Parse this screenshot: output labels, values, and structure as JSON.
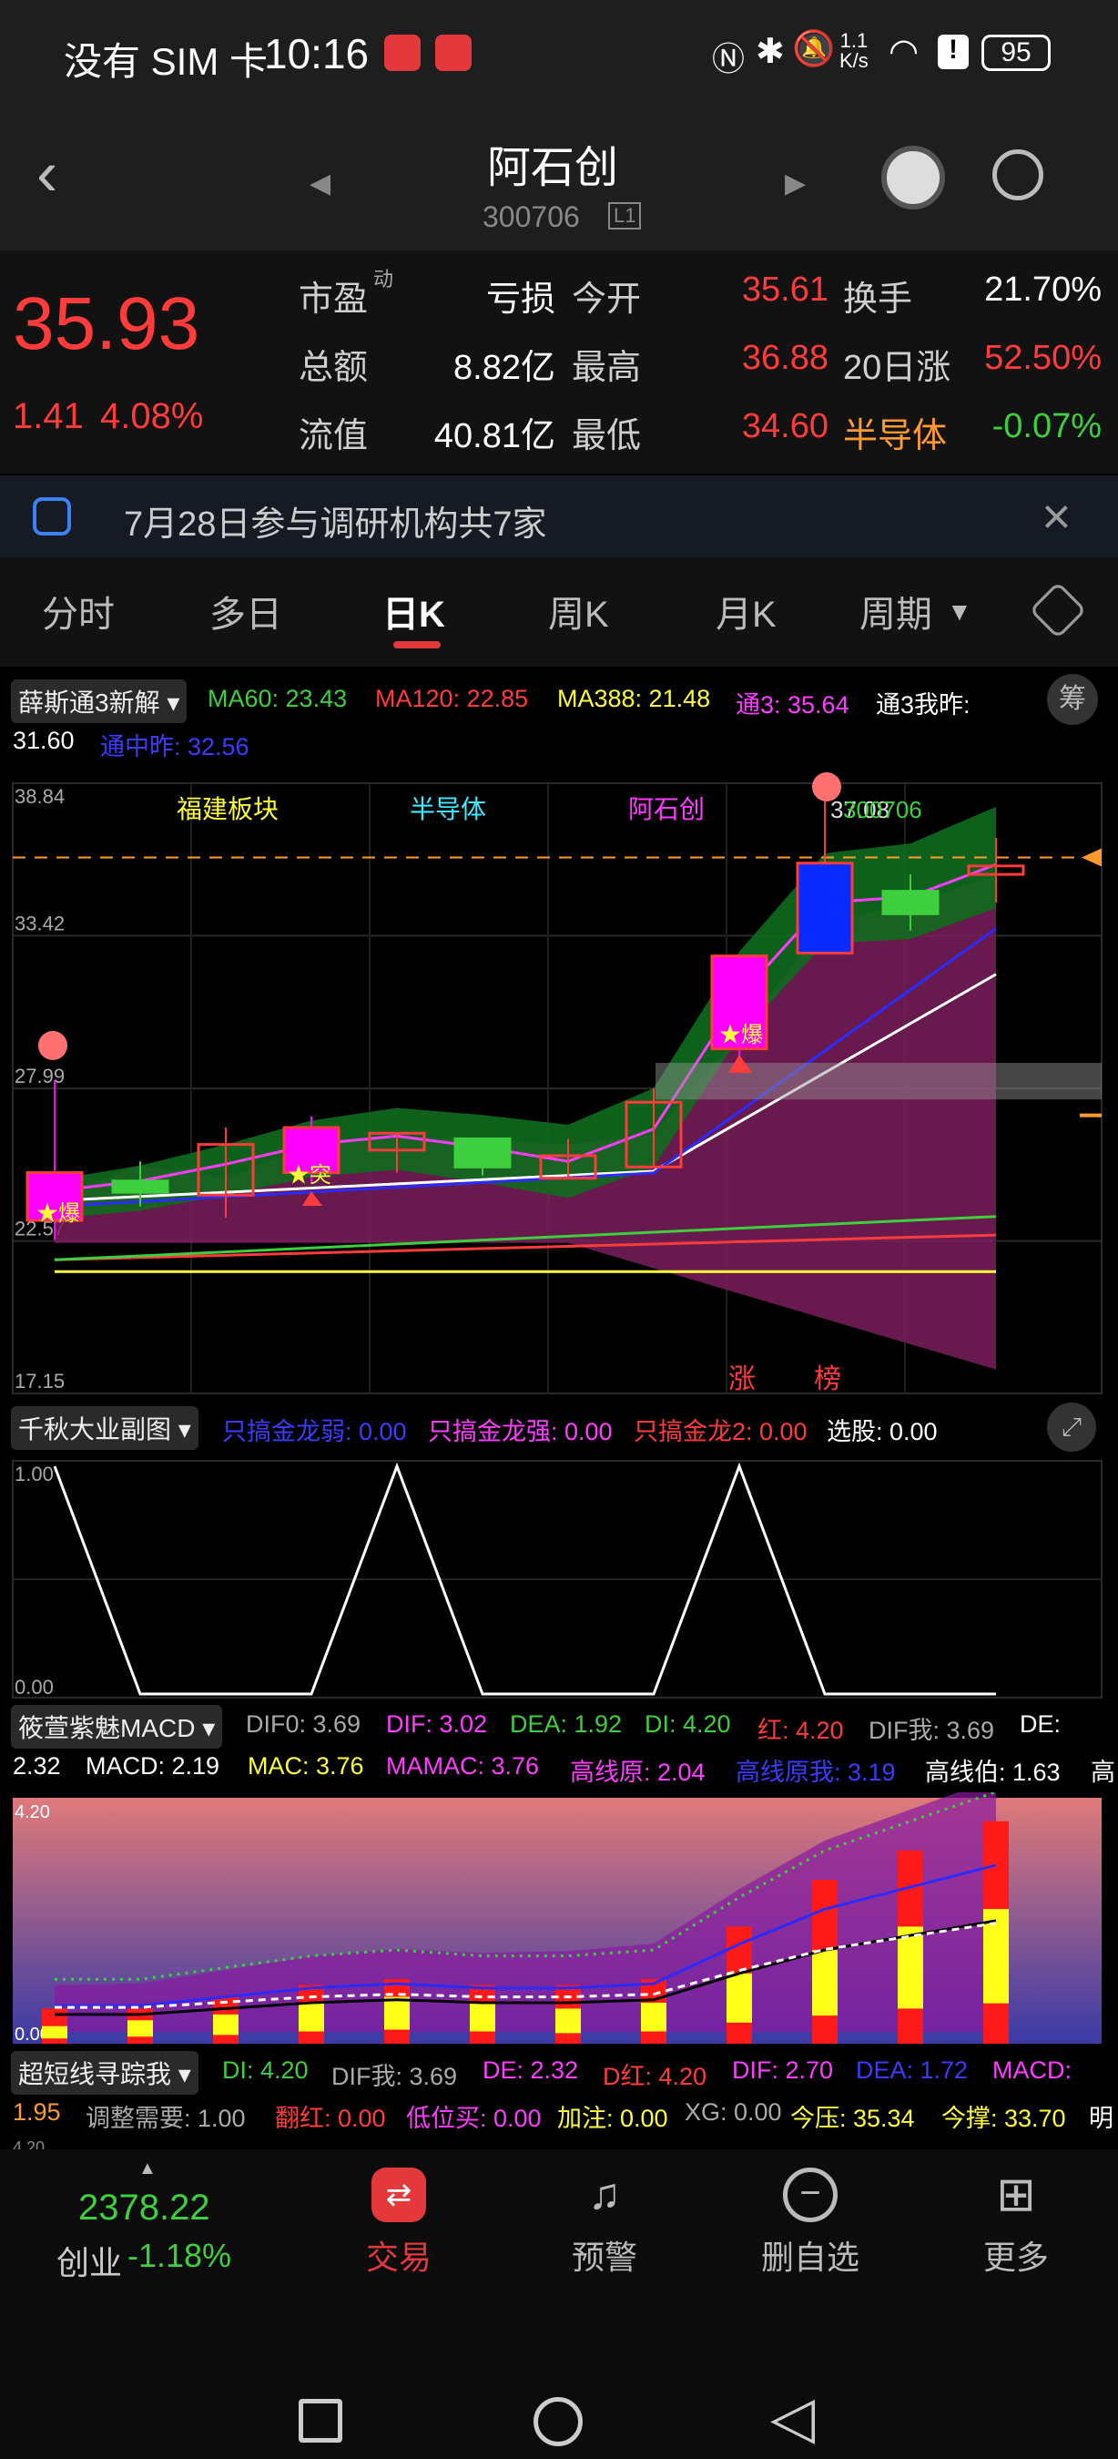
{
  "status_bar": {
    "carrier": "没有 SIM 卡",
    "time": "10:16",
    "net_speed_top": "1.1",
    "net_speed_bottom": "K/s",
    "battery": "95"
  },
  "header": {
    "title": "阿石创",
    "code": "300706",
    "badge": "L1"
  },
  "quote": {
    "price": "35.93",
    "change": "1.41",
    "change_pct": "4.08%",
    "rows": [
      {
        "l1": "市盈",
        "sup": "动",
        "v1": "亏损",
        "l2": "今开",
        "v2": "35.61",
        "l3": "换手",
        "v3": "21.70%"
      },
      {
        "l1": "总额",
        "sup": "",
        "v1": "8.82亿",
        "l2": "最高",
        "v2": "36.88",
        "l3": "20日涨",
        "v3": "52.50%"
      },
      {
        "l1": "流值",
        "sup": "",
        "v1": "40.81亿",
        "l2": "最低",
        "v2": "34.60",
        "l3": "半导体",
        "v3": "-0.07%"
      }
    ]
  },
  "notice": {
    "text": "7月28日参与调研机构共7家"
  },
  "tabs": [
    "分时",
    "多日",
    "日K",
    "周K",
    "月K",
    "周期"
  ],
  "main_chart": {
    "indicator": "薛斯通3新解",
    "legend": {
      "ma60": "MA60: 23.43",
      "ma120": "MA120: 22.85",
      "ma388": "MA388: 21.48",
      "tong3": "通3: 35.64",
      "tong3_wo": "通3我昨:",
      "tong3_wo_val": "31.60",
      "tongzhong": "通中昨: 32.56"
    },
    "side_btn": "筹",
    "y_labels": [
      "38.84",
      "33.42",
      "27.99",
      "22.57",
      "17.15"
    ],
    "labels": {
      "sector1": "福建板块",
      "sector2": "半导体",
      "sector3": "阿石创",
      "code_overlay": "300706",
      "price_overlay": "37.08"
    },
    "markers": {
      "bao": "★爆",
      "tu": "★突",
      "zhang": "涨",
      "bang": "榜"
    }
  },
  "chart_data": [
    {
      "type": "candlestick",
      "title": "日K",
      "ylim": [
        17.15,
        38.84
      ],
      "candles": [
        {
          "open": 23.3,
          "close": 25.0,
          "high": 28.3,
          "low": 22.6,
          "color": "magenta"
        },
        {
          "open": 24.7,
          "close": 24.3,
          "high": 25.4,
          "low": 23.8,
          "color": "green"
        },
        {
          "open": 24.2,
          "close": 26.0,
          "high": 26.6,
          "low": 23.4,
          "color": "red"
        },
        {
          "open": 25.0,
          "close": 26.6,
          "high": 27.0,
          "low": 24.6,
          "color": "magenta"
        },
        {
          "open": 25.8,
          "close": 26.4,
          "high": 26.4,
          "low": 25.0,
          "color": "red"
        },
        {
          "open": 26.2,
          "close": 25.2,
          "high": 26.2,
          "low": 24.9,
          "color": "green"
        },
        {
          "open": 24.8,
          "close": 25.6,
          "high": 26.2,
          "low": 24.8,
          "color": "red"
        },
        {
          "open": 25.2,
          "close": 27.5,
          "high": 28.0,
          "low": 25.2,
          "color": "red"
        },
        {
          "open": 29.4,
          "close": 32.7,
          "high": 32.7,
          "low": 28.8,
          "color": "magenta"
        },
        {
          "open": 32.8,
          "close": 36.0,
          "high": 38.5,
          "low": 32.8,
          "color": "blue"
        },
        {
          "open": 34.2,
          "close": 35.0,
          "high": 35.6,
          "low": 33.6,
          "color": "green"
        },
        {
          "open": 35.6,
          "close": 35.9,
          "high": 36.9,
          "low": 34.6,
          "color": "red"
        }
      ]
    },
    {
      "type": "line",
      "title": "千秋大业副图",
      "ylim": [
        0.0,
        1.0
      ],
      "values": [
        1,
        0,
        0,
        0,
        1,
        0,
        0,
        0,
        1,
        0,
        0,
        0
      ]
    },
    {
      "type": "bar",
      "title": "筱萱紫魅MACD",
      "ylim": [
        0.0,
        4.2
      ],
      "red": [
        0.6,
        0.6,
        0.8,
        1.0,
        1.1,
        1.0,
        1.0,
        1.1,
        2.0,
        2.8,
        3.3,
        3.8
      ],
      "yellow": [
        0.3,
        0.4,
        0.5,
        0.7,
        0.8,
        0.7,
        0.6,
        0.7,
        1.2,
        1.6,
        2.0,
        2.3
      ]
    }
  ],
  "sub_chart": {
    "indicator": "千秋大业副图",
    "legend": {
      "a": "只搞金龙弱: 0.00",
      "b": "只搞金龙强: 0.00",
      "c": "只搞金龙2: 0.00",
      "d": "选股: 0.00"
    },
    "y_top": "1.00",
    "y_bottom": "0.00"
  },
  "macd_chart": {
    "indicator": "筱萱紫魅MACD",
    "legend_row1": {
      "a": "DIF0: 3.69",
      "b": "DIF: 3.02",
      "c": "DEA: 1.92",
      "d": "DI: 4.20",
      "e": "红: 4.20",
      "f": "DIF我: 3.69",
      "g": "DE:"
    },
    "legend_row2": {
      "a": "2.32",
      "b": "MACD: 2.19",
      "c": "MAC: 3.76",
      "d": "MAMAC: 3.76",
      "e": "高线原: 2.04",
      "f": "高线原我: 3.19",
      "g": "高线伯: 1.63",
      "h": "高"
    },
    "y_top": "4.20",
    "y_bottom": "0.00"
  },
  "trend_chart": {
    "indicator": "超短线寻踪我",
    "legend_row1": {
      "a": "DI: 4.20",
      "b": "DIF我: 3.69",
      "c": "DE: 2.32",
      "d": "D红: 4.20",
      "e": "DIF: 2.70",
      "f": "DEA: 1.72",
      "g": "MACD:"
    },
    "legend_row2": {
      "a": "1.95",
      "b": "调整需要: 1.00",
      "c": "翻红: 0.00",
      "d": "低位买: 0.00",
      "e": "加注: 0.00",
      "f": "XG: 0.00",
      "g": "今压: 35.34",
      "h": "今撑: 33.70",
      "i": "明"
    },
    "y_top": "4.20"
  },
  "bottom_nav": {
    "index_value": "2378.22",
    "index_name": "创业",
    "index_change": "-1.18%",
    "items": [
      "交易",
      "预警",
      "删自选",
      "更多"
    ]
  }
}
